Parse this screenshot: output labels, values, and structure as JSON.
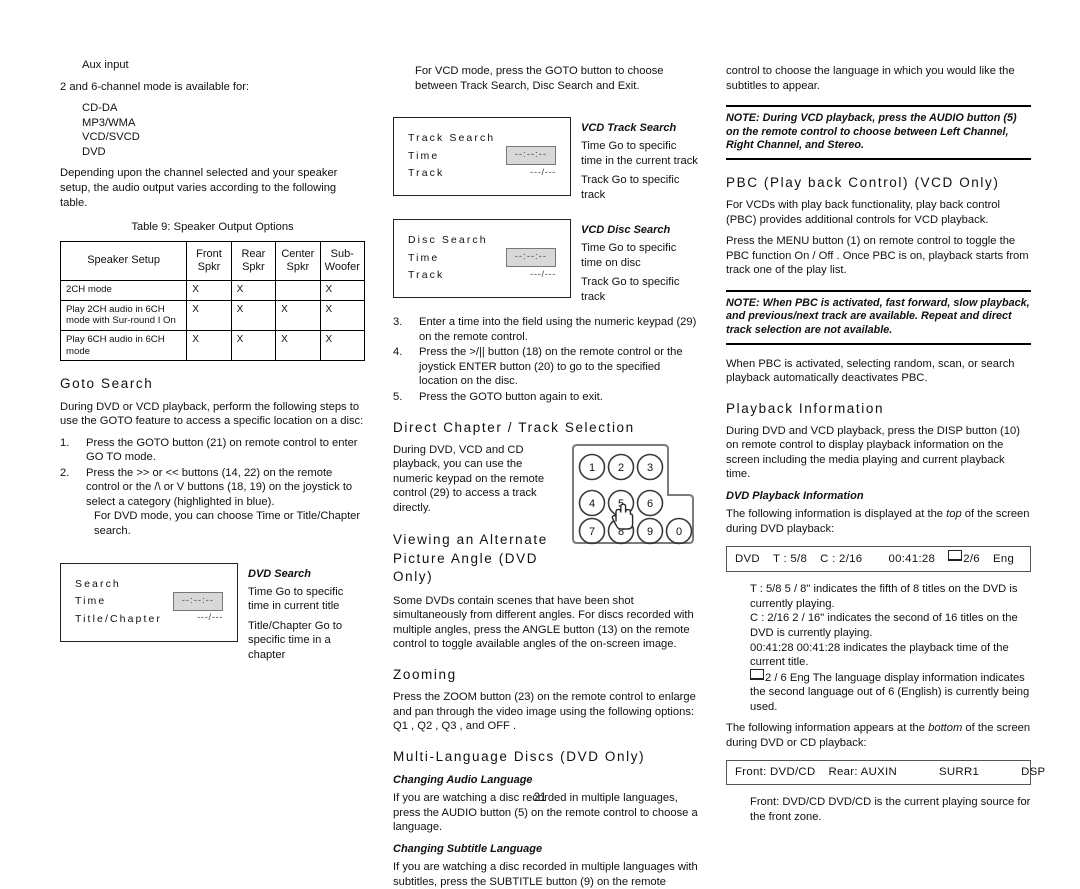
{
  "page": {
    "number": "21"
  },
  "left": {
    "aux_input": "Aux input",
    "channel_modes_intro": "2 and 6-channel mode is available for:",
    "formats": [
      "CD-DA",
      "MP3/WMA",
      "VCD/SVCD",
      "DVD"
    ],
    "depending_para": "Depending upon the channel selected and your speaker setup, the audio output varies according to the following table.",
    "table_caption": "Table 9: Speaker Output Options",
    "table": {
      "headers": [
        "Speaker Setup",
        "Front Spkr",
        "Rear Spkr",
        "Center Spkr",
        "Sub-Woofer"
      ],
      "rows": [
        {
          "label": "2CH mode",
          "cells": [
            "X",
            "X",
            "",
            "X"
          ]
        },
        {
          "label": "Play 2CH audio in 6CH mode with Sur-round I On",
          "cells": [
            "X",
            "X",
            "X",
            "X"
          ]
        },
        {
          "label": "Play 6CH audio in 6CH mode",
          "cells": [
            "X",
            "X",
            "X",
            "X"
          ]
        }
      ]
    },
    "goto_heading": "Goto Search",
    "goto_intro": "During DVD or VCD playback, perform the following steps to use the GOTO feature to access a specific location on a disc:",
    "goto_steps": [
      {
        "num": "1.",
        "text": "Press the GOTO button (21) on remote control to enter GO TO  mode."
      },
      {
        "num": "2.",
        "text": "Press the >> or << buttons (14, 22) on the remote control or the /\\ or V buttons (18, 19) on the joystick to select a category (highlighted in blue).",
        "sub": "For DVD mode, you can choose Time or Title/Chapter search."
      }
    ],
    "dvd_search_osd": {
      "title": "Search",
      "rows": [
        {
          "label": "Time",
          "value": "--:--:--",
          "boxed": true
        },
        {
          "label": "Title/Chapter",
          "value": "---/---",
          "boxed": false
        }
      ]
    },
    "dvd_search_caption": "DVD Search",
    "dvd_search_defs": [
      "Time   Go to specific time in current title",
      "Title/Chapter   Go to specific time in a chapter"
    ]
  },
  "middle": {
    "vcd_intro": "For VCD mode, press the GOTO button to choose between Track Search, Disc Search and Exit.",
    "track_search_osd": {
      "title": "Track Search",
      "rows": [
        {
          "label": "Time",
          "value": "--:--:--",
          "boxed": true
        },
        {
          "label": "Track",
          "value": "---/---",
          "boxed": false
        }
      ]
    },
    "track_search_caption": "VCD Track Search",
    "track_search_defs": [
      "Time   Go to specific time in the current track",
      "Track   Go to specific track"
    ],
    "disc_search_osd": {
      "title": "Disc Search",
      "rows": [
        {
          "label": "Time",
          "value": "--:--:--",
          "boxed": true
        },
        {
          "label": "Track",
          "value": "---/---",
          "boxed": false
        }
      ]
    },
    "disc_search_caption": "VCD Disc Search",
    "disc_search_defs": [
      "Time   Go to specific time on disc",
      "Track   Go to specific track"
    ],
    "steps": [
      {
        "num": "3.",
        "text": "Enter a time into the field using the numeric keypad (29) on the remote control."
      },
      {
        "num": "4.",
        "text": "Press the >/|| button (18) on the remote control or the joystick ENTER button (20) to go to the specified location on the disc."
      },
      {
        "num": "5.",
        "text": "Press the GOTO button again to exit."
      }
    ],
    "direct_heading": "Direct Chapter /  Track Selection",
    "direct_text": "During DVD, VCD and CD playback, you can use the numeric keypad on the remote control (29) to access a track directly.",
    "keypad": {
      "keys": [
        "1",
        "2",
        "3",
        "4",
        "5",
        "6",
        "7",
        "8",
        "9",
        "0"
      ],
      "cursor_on": "5"
    },
    "angle_heading": "Viewing an Alternate Picture Angle (DVD Only)",
    "angle_text": "Some DVDs contain scenes that have been shot simultaneously from different angles. For discs recorded with multiple angles, press the ANGLE button (13) on the remote control to toggle available angles of the on-screen image.",
    "zoom_heading": "Zooming",
    "zoom_text": "Press the ZOOM button (23) on the remote control to enlarge and pan through the video image using the following options:  Q1 ,  Q2 ,  Q3 , and  OFF .",
    "multilang_heading": "Multi-Language Discs (DVD Only)",
    "audio_lang_heading": "Changing Audio Language",
    "audio_lang_text": "If you are watching a disc recorded in multiple languages, press the AUDIO button (5) on the remote control to choose a language.",
    "subtitle_lang_heading": "Changing Subtitle Language",
    "subtitle_lang_text": "If you are watching a disc recorded in multiple languages with subtitles, press the SUBTITLE button (9) on the remote"
  },
  "right": {
    "continuation": "control to choose the language in which you would like the subtitles to appear.",
    "note1": "NOTE: During VCD playback, press the AUDIO button (5) on the remote control to choose between Left Channel, Right Channel, and Stereo.",
    "pbc_heading": "PBC (Play back Control) (VCD Only)",
    "pbc_text1": "For VCDs with play back functionality, play back control (PBC) provides additional controls for VCD playback.",
    "pbc_text2": "Press the MENU button (1) on remote control to toggle the PBC function  On / Off . Once PBC is on, playback starts from track one of the play list.",
    "note2": "NOTE: When PBC is activated, fast forward, slow playback, and previous/next track are available. Repeat and direct track selection are not available.",
    "pbc_text3": "When PBC is activated, selecting random, scan, or search playback automatically deactivates PBC.",
    "playback_heading": "Playback Information",
    "playback_text": "During DVD and VCD playback, press the DISP button (10) on remote control to display playback information on the screen including the media playing and current playback time.",
    "dvd_pb_heading": "DVD Playback Information",
    "dvd_pb_text_a": "The following information is displayed at the ",
    "dvd_pb_text_italic": "top",
    "dvd_pb_text_b": " of the screen during DVD playback:",
    "top_strip": {
      "media": "DVD",
      "title": "T : 5/8",
      "chapter": "C : 2/16",
      "time": "00:41:28",
      "lang": "2/6",
      "lang_code": "Eng"
    },
    "top_defs": [
      "T : 5/8    5 / 8\" indicates the fifth of 8 titles on the DVD is currently playing.",
      "C : 2/16    2 / 16\" indicates the second of 16 titles on the DVD is currently playing.",
      "00:41:28    00:41:28  indicates the playback time of the current title.",
      "2 / 6 Eng   The language display information indicates the second language out of 6 (English) is currently being used."
    ],
    "bottom_text_a": "The following information appears at the ",
    "bottom_text_italic": "bottom",
    "bottom_text_b": " of the screen during DVD or CD playback:",
    "bottom_strip": {
      "front": "Front:  DVD/CD",
      "rear": "Rear:  AUXIN",
      "surr": "SURR1",
      "dsp": "DSP"
    },
    "bottom_def": "Front: DVD/CD    DVD/CD  is the current playing source for the front zone."
  }
}
